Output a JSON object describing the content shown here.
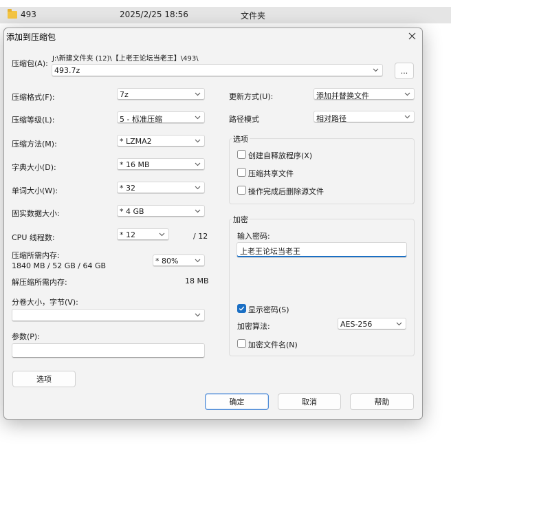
{
  "explorer": {
    "name": "493",
    "date": "2025/2/25 18:56",
    "type": "文件夹"
  },
  "dialog": {
    "title": "添加到压缩包",
    "archive_label": "压缩包(A):",
    "archive_path": "J:\\新建文件夹 (12)\\【上老王论坛当老王】\\493\\",
    "archive_name": "493.7z",
    "browse_label": "...",
    "format_label": "压缩格式(F):",
    "format_value": "7z",
    "level_label": "压缩等级(L):",
    "level_value": "5 - 标准压缩",
    "method_label": "压缩方法(M):",
    "method_value": "* LZMA2",
    "dict_label": "字典大小(D):",
    "dict_value": "* 16 MB",
    "word_label": "单词大小(W):",
    "word_value": "* 32",
    "solid_label": "固实数据大小:",
    "solid_value": "* 4 GB",
    "threads_label": "CPU 线程数:",
    "threads_value": "* 12",
    "threads_total": "/ 12",
    "mem_comp_label": "压缩所需内存:",
    "mem_comp_detail": "1840 MB / 52 GB / 64 GB",
    "mem_comp_value": "* 80%",
    "mem_decomp_label": "解压缩所需内存:",
    "mem_decomp_value": "18 MB",
    "volume_label": "分卷大小，字节(V):",
    "volume_value": "",
    "params_label": "参数(P):",
    "params_value": "",
    "options_button": "选项",
    "update_label": "更新方式(U):",
    "update_value": "添加并替换文件",
    "pathmode_label": "路径模式",
    "pathmode_value": "相对路径",
    "options_group": {
      "title": "选项",
      "sfx": "创建自释放程序(X)",
      "shared": "压缩共享文件",
      "delete_after": "操作完成后删除源文件"
    },
    "encryption_group": {
      "title": "加密",
      "password_label": "输入密码:",
      "password_value": "上老王论坛当老王",
      "show_password": "显示密码(S)",
      "method_label": "加密算法:",
      "method_value": "AES-256",
      "encrypt_names": "加密文件名(N)"
    },
    "ok_button": "确定",
    "cancel_button": "取消",
    "help_button": "帮助"
  },
  "colors": {
    "accent": "#1a6fc4",
    "dialog_bg": "#f3f3f3"
  }
}
